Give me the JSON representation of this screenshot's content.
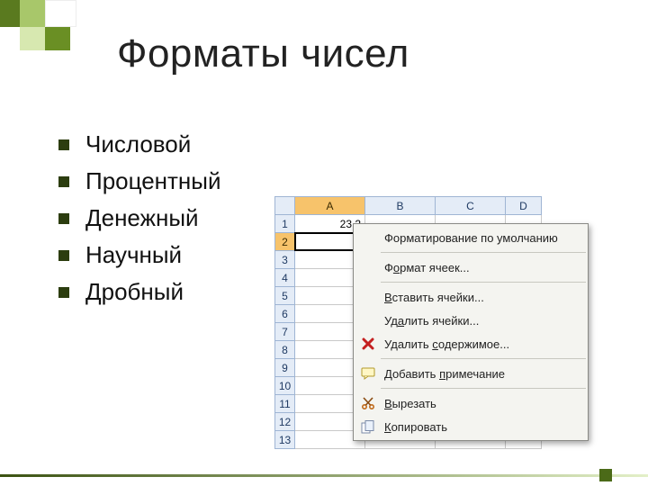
{
  "title": "Форматы чисел",
  "bullets": [
    {
      "label": "Числовой"
    },
    {
      "label": "Процентный"
    },
    {
      "label": "Денежный"
    },
    {
      "label": "Научный"
    },
    {
      "label": "Дробный"
    }
  ],
  "sheet": {
    "columns": [
      "A",
      "B",
      "C",
      "D"
    ],
    "rows": [
      "1",
      "2",
      "3",
      "4",
      "5",
      "6",
      "7",
      "8",
      "9",
      "10",
      "11",
      "12",
      "13"
    ],
    "selected_row": "2",
    "a1_value": "23,2"
  },
  "menu": {
    "items": [
      {
        "key": "default_format",
        "label": "Форматирование по умолчанию",
        "icon": null
      },
      {
        "sep": true
      },
      {
        "key": "cell_format",
        "label": "Формат ячеек...",
        "icon": null,
        "u_index": 1
      },
      {
        "sep": true
      },
      {
        "key": "insert_cells",
        "label": "Вставить ячейки...",
        "icon": null,
        "u_index": 0
      },
      {
        "key": "delete_cells",
        "label": "Удалить ячейки...",
        "icon": null,
        "u_index": 2
      },
      {
        "key": "delete_content",
        "label": "Удалить содержимое...",
        "icon": "delete-x",
        "u_index": 8
      },
      {
        "sep": true
      },
      {
        "key": "add_comment",
        "label": "Добавить примечание",
        "icon": "comment",
        "u_index": 9
      },
      {
        "sep": true
      },
      {
        "key": "cut",
        "label": "Вырезать",
        "icon": "scissors",
        "u_index": 0
      },
      {
        "key": "copy",
        "label": "Копировать",
        "icon": "copy",
        "u_index": 0
      }
    ]
  }
}
